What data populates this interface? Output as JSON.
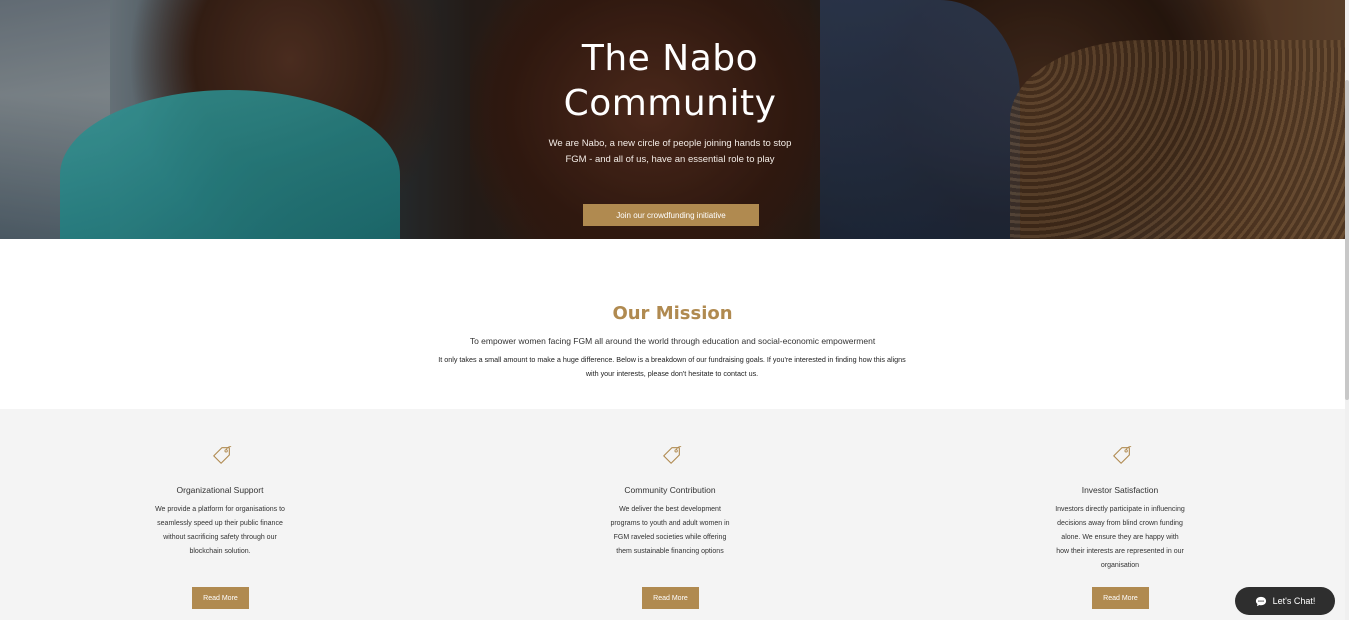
{
  "hero": {
    "title_line1": "The Nabo",
    "title_line2": "Community",
    "subtitle": "We are Nabo, a new circle of people joining hands to stop FGM - and all of us, have an essential role to play",
    "cta_label": "Join our crowdfunding initiative"
  },
  "mission": {
    "title": "Our Mission",
    "lead": "To empower women facing FGM all around the world through education and social-economic empowerment",
    "body": "It only takes a small amount to make a huge difference. Below is a breakdown of our fundraising goals. If you're interested in finding how this aligns with your interests, please don't hesitate to contact us."
  },
  "features": [
    {
      "title": "Organizational Support",
      "text": "We provide a platform for organisations to seamlessly speed up their public finance without sacrificing safety through our blockchain solution.",
      "button": "Read More",
      "icon": "price-tag-icon"
    },
    {
      "title": "Community Contribution",
      "text": "We deliver the best development programs to youth and adult women in FGM raveled societies while offering them  sustainable financing options",
      "button": "Read More",
      "icon": "price-tag-icon"
    },
    {
      "title": "Investor Satisfaction",
      "text": "Investors directly participate in influencing decisions away from blind crown funding alone. We ensure they are happy with how their interests are represented in our organisation",
      "button": "Read More",
      "icon": "price-tag-icon"
    }
  ],
  "chat": {
    "label": "Let's Chat!",
    "icon": "chat-bubble-icon"
  },
  "colors": {
    "accent": "#b08a50",
    "section_gray": "#f4f4f4",
    "chat_bg": "#2e2e2e"
  }
}
